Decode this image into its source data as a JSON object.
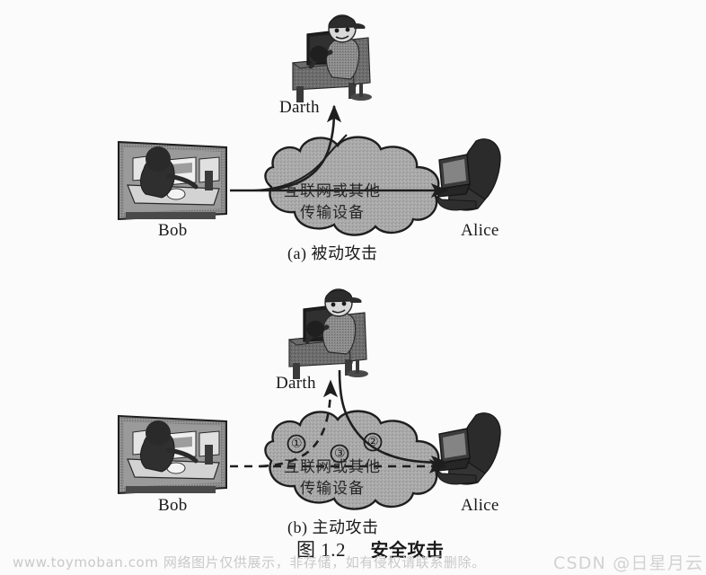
{
  "figure": {
    "caption_number": "图 1.2",
    "caption_title": "安全攻击",
    "cloud_label_line1": "互联网或其他",
    "cloud_label_line2": "传输设备"
  },
  "panel_a": {
    "subcaption": "(a) 被动攻击",
    "sender_label": "Bob",
    "receiver_label": "Alice",
    "attacker_label": "Darth",
    "cloud_line1": "互联网或其他",
    "cloud_line2": "传输设备"
  },
  "panel_b": {
    "subcaption": "(b) 主动攻击",
    "sender_label": "Bob",
    "receiver_label": "Alice",
    "attacker_label": "Darth",
    "cloud_line1": "互联网或其他",
    "cloud_line2": "传输设备",
    "step_markers": [
      "①",
      "②",
      "③"
    ],
    "step1": "①",
    "step2": "②",
    "step3": "③"
  },
  "watermarks": {
    "left": "www.toymoban.com 网络图片仅供展示，非存储，如有侵权请联系删除。",
    "right": "CSDN @日星月云"
  },
  "colors": {
    "background": "#fbfbfb",
    "ink": "#1a1a1a",
    "cloud_fill": "#a9a9a9",
    "cloud_stroke": "#1e1e1e",
    "watermark": "#cccccc"
  }
}
